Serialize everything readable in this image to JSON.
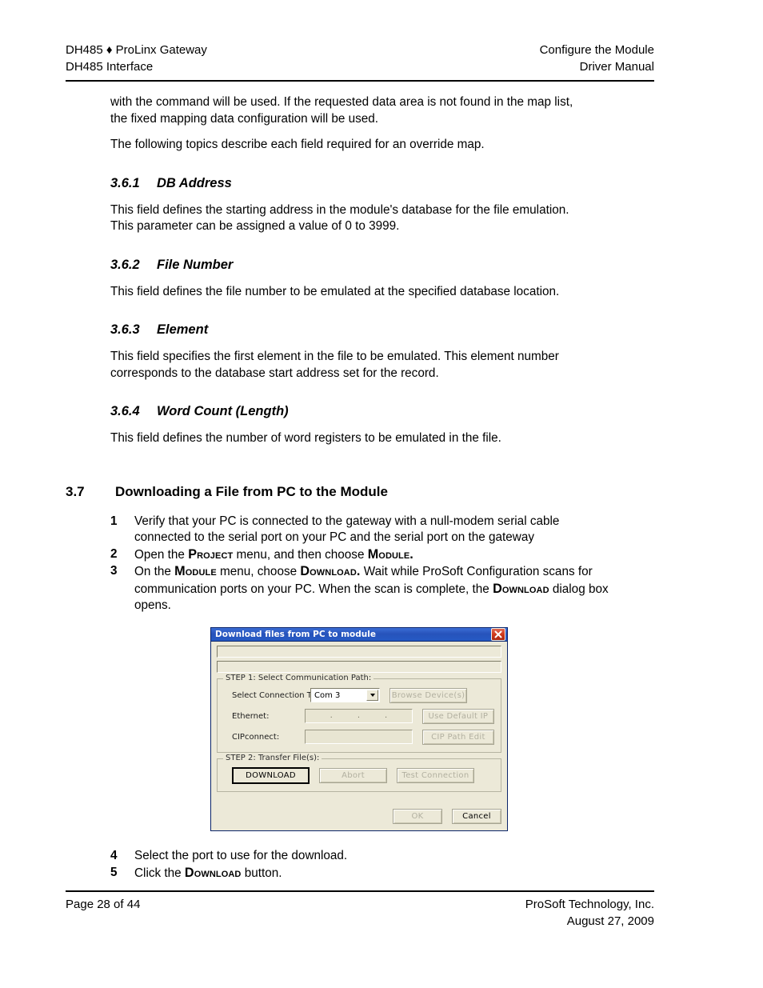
{
  "header": {
    "left_line1": "DH485 ♦ ProLinx Gateway",
    "left_line2": "DH485 Interface",
    "right_line1": "Configure the Module",
    "right_line2": "Driver Manual"
  },
  "body": {
    "para_continuation": "with the command will be used. If the requested data area is not found in the map list, the fixed mapping data configuration will be used.",
    "para_following": "The following topics describe each field required for an override map."
  },
  "sections": [
    {
      "num": "3.6.1",
      "title": "DB Address",
      "text": "This field defines the starting address in the module's database for the file emulation. This parameter can be assigned a value of 0 to 3999."
    },
    {
      "num": "3.6.2",
      "title": "File Number",
      "text": "This field defines the file number to be emulated at the specified database location."
    },
    {
      "num": "3.6.3",
      "title": "Element",
      "text": "This field specifies the first element in the file to be emulated. This element number corresponds to the database start address set for the record."
    },
    {
      "num": "3.6.4",
      "title": "Word Count (Length)",
      "text": "This field defines the number of word registers to be emulated in the file."
    }
  ],
  "major_section": {
    "num": "3.7",
    "title": "Downloading a File from PC to the Module"
  },
  "steps_before": [
    {
      "marker": "1",
      "parts": [
        {
          "t": "Verify that your PC is connected to the gateway with a null-modem serial cable connected to the serial port on your PC and the serial port on the gateway",
          "sc": false
        }
      ]
    },
    {
      "marker": "2",
      "parts": [
        {
          "t": "Open the ",
          "sc": false
        },
        {
          "t": "Project",
          "sc": true
        },
        {
          "t": " menu, and then choose ",
          "sc": false
        },
        {
          "t": "Module.",
          "sc": true
        }
      ]
    },
    {
      "marker": "3",
      "parts": [
        {
          "t": "On the ",
          "sc": false
        },
        {
          "t": "Module",
          "sc": true
        },
        {
          "t": " menu, choose ",
          "sc": false
        },
        {
          "t": "Download.",
          "sc": true
        },
        {
          "t": " Wait while ProSoft Configuration scans for communication ports on your PC. When the scan is complete, the ",
          "sc": false
        },
        {
          "t": "Download",
          "sc": true
        },
        {
          "t": " dialog box opens.",
          "sc": false
        }
      ]
    }
  ],
  "steps_after": [
    {
      "marker": "4",
      "parts": [
        {
          "t": "Select the port to use for the download.",
          "sc": false
        }
      ]
    },
    {
      "marker": "5",
      "parts": [
        {
          "t": "Click the ",
          "sc": false
        },
        {
          "t": "Download",
          "sc": true
        },
        {
          "t": " button.",
          "sc": false
        }
      ]
    }
  ],
  "dialog": {
    "title": "Download files from PC to module",
    "close_icon": "close-icon",
    "status_field_1": "",
    "status_field_2": "",
    "step1": {
      "legend": "STEP 1: Select Communication Path:",
      "connection_type_label": "Select Connection Type:",
      "connection_type_value": "Com 3",
      "browse_button": "Browse Device(s)",
      "ethernet_label": "Ethernet:",
      "ethernet_value": "",
      "ethernet_separator": ".",
      "use_default_ip_button": "Use Default IP",
      "cipconnect_label": "CIPconnect:",
      "cipconnect_value": "",
      "cip_path_edit_button": "CIP Path Edit"
    },
    "step2": {
      "legend": "STEP 2: Transfer File(s):",
      "download_button": "DOWNLOAD",
      "abort_button": "Abort",
      "test_connection_button": "Test Connection"
    },
    "ok_button": "OK",
    "cancel_button": "Cancel",
    "colors": {
      "titlebar": "#2753bb",
      "close": "#cf3a1c",
      "face": "#ece9d8"
    }
  },
  "footer": {
    "left": "Page 28 of 44",
    "right_line1": "ProSoft Technology, Inc.",
    "right_line2": "August 27, 2009"
  }
}
